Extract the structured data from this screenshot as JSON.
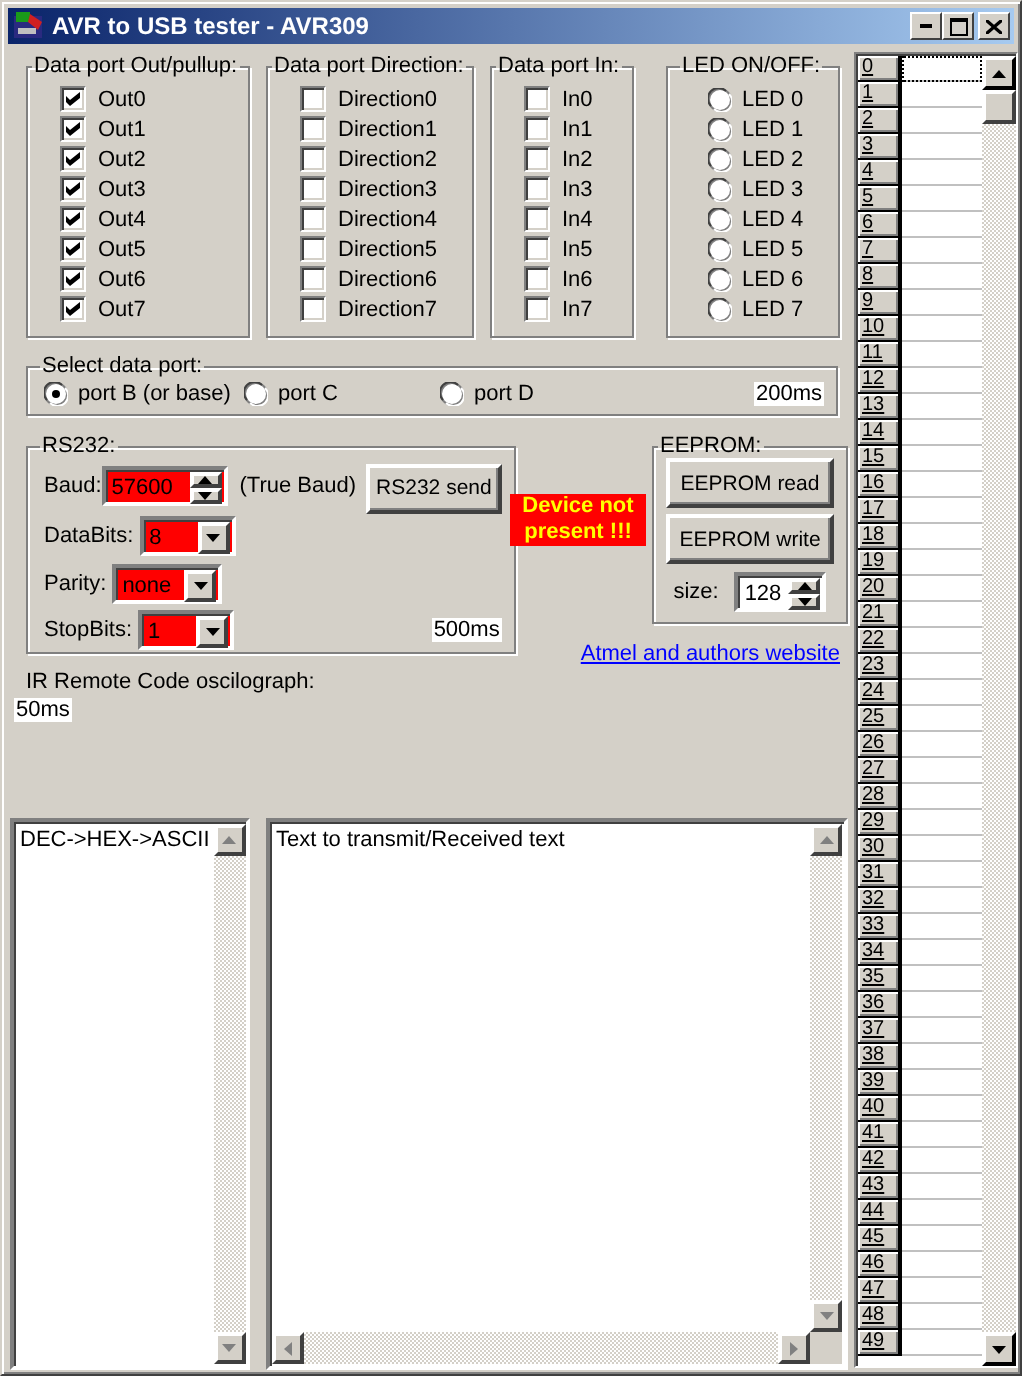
{
  "window": {
    "title": "AVR to USB tester - AVR309"
  },
  "out_group": {
    "title": "Data port Out/pullup:",
    "items": [
      {
        "label": "Out0",
        "checked": true
      },
      {
        "label": "Out1",
        "checked": true
      },
      {
        "label": "Out2",
        "checked": true
      },
      {
        "label": "Out3",
        "checked": true
      },
      {
        "label": "Out4",
        "checked": true
      },
      {
        "label": "Out5",
        "checked": true
      },
      {
        "label": "Out6",
        "checked": true
      },
      {
        "label": "Out7",
        "checked": true
      }
    ]
  },
  "direction_group": {
    "title": "Data port Direction:",
    "items": [
      {
        "label": "Direction0",
        "checked": false
      },
      {
        "label": "Direction1",
        "checked": false
      },
      {
        "label": "Direction2",
        "checked": false
      },
      {
        "label": "Direction3",
        "checked": false
      },
      {
        "label": "Direction4",
        "checked": false
      },
      {
        "label": "Direction5",
        "checked": false
      },
      {
        "label": "Direction6",
        "checked": false
      },
      {
        "label": "Direction7",
        "checked": false
      }
    ]
  },
  "in_group": {
    "title": "Data port In:",
    "items": [
      {
        "label": "In0",
        "checked": false
      },
      {
        "label": "In1",
        "checked": false
      },
      {
        "label": "In2",
        "checked": false
      },
      {
        "label": "In3",
        "checked": false
      },
      {
        "label": "In4",
        "checked": false
      },
      {
        "label": "In5",
        "checked": false
      },
      {
        "label": "In6",
        "checked": false
      },
      {
        "label": "In7",
        "checked": false
      }
    ]
  },
  "led_group": {
    "title": "LED ON/OFF:",
    "items": [
      {
        "label": "LED 0",
        "selected": false
      },
      {
        "label": "LED 1",
        "selected": false
      },
      {
        "label": "LED 2",
        "selected": false
      },
      {
        "label": "LED 3",
        "selected": false
      },
      {
        "label": "LED 4",
        "selected": false
      },
      {
        "label": "LED 5",
        "selected": false
      },
      {
        "label": "LED 6",
        "selected": false
      },
      {
        "label": "LED 7",
        "selected": false
      }
    ]
  },
  "port_select": {
    "title": "Select data port:",
    "options": [
      {
        "label": "port B (or base)",
        "selected": true
      },
      {
        "label": "port C",
        "selected": false
      },
      {
        "label": "port D",
        "selected": false
      }
    ],
    "interval": "200ms"
  },
  "rs232": {
    "title": "RS232:",
    "baud_label": "Baud:",
    "baud": "57600",
    "true_baud": "(True Baud)",
    "send_button": "RS232 send",
    "databits_label": "DataBits:",
    "databits": "8",
    "parity_label": "Parity:",
    "parity": "none",
    "stopbits_label": "StopBits:",
    "stopbits": "1",
    "interval": "500ms"
  },
  "status": "Device not present !!!",
  "eeprom": {
    "title": "EEPROM:",
    "read_button": "EEPROM read",
    "write_button": "EEPROM write",
    "size_label": "size:",
    "size": "128"
  },
  "link": "Atmel and authors website",
  "ir": {
    "title": "IR Remote Code oscilograph:",
    "interval": "50ms"
  },
  "converter_box": {
    "value": "DEC->HEX->ASCII"
  },
  "text_box": {
    "value": "Text to transmit/Received text"
  },
  "grid": {
    "rows": [
      "0",
      "1",
      "2",
      "3",
      "4",
      "5",
      "6",
      "7",
      "8",
      "9",
      "10",
      "11",
      "12",
      "13",
      "14",
      "15",
      "16",
      "17",
      "18",
      "19",
      "20",
      "21",
      "22",
      "23",
      "24",
      "25",
      "26",
      "27",
      "28",
      "29",
      "30",
      "31",
      "32",
      "33",
      "34",
      "35",
      "36",
      "37",
      "38",
      "39",
      "40",
      "41",
      "42",
      "43",
      "44",
      "45",
      "46",
      "47",
      "48",
      "49"
    ]
  }
}
